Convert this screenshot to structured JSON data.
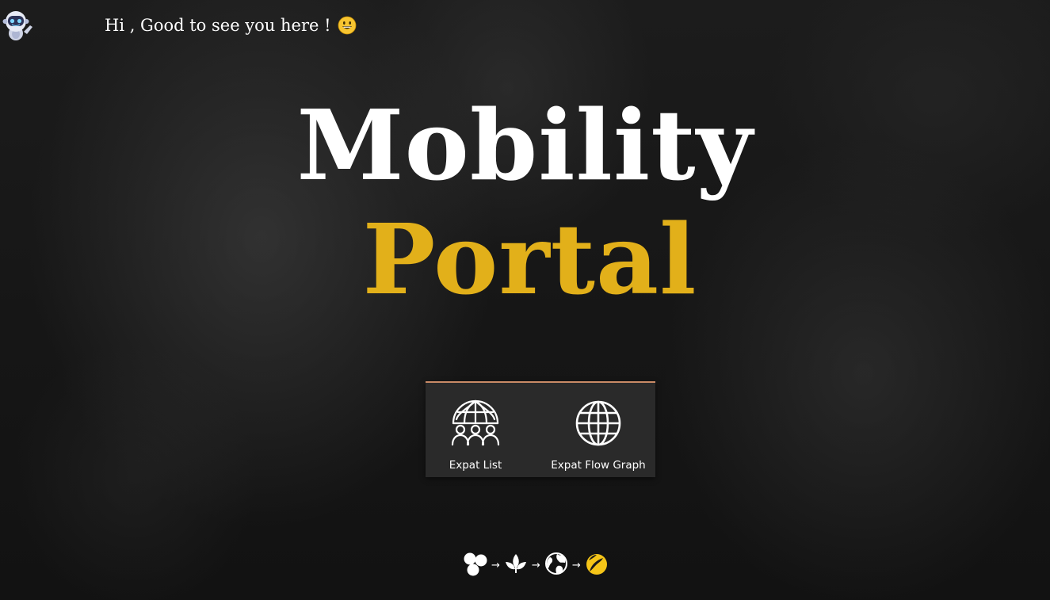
{
  "greeting": {
    "text": "Hi , Good to see you here !",
    "emoji_icon": "grinning-face-icon"
  },
  "hero": {
    "title_line1": "Mobility",
    "title_line2": "Portal",
    "colors": {
      "line1": "#ffffff",
      "line2": "#e2b01a"
    }
  },
  "menu": {
    "accent_color": "#c98a66",
    "items": [
      {
        "label": "Expat List",
        "icon": "globe-people-icon"
      },
      {
        "label": "Expat Flow Graph",
        "icon": "globe-icon"
      }
    ]
  },
  "process": {
    "arrow": "→",
    "steps": [
      {
        "icon": "three-circles-icon"
      },
      {
        "icon": "sprout-icon"
      },
      {
        "icon": "world-icon"
      },
      {
        "icon": "yellow-orb-icon",
        "color": "#f5c518"
      }
    ]
  }
}
